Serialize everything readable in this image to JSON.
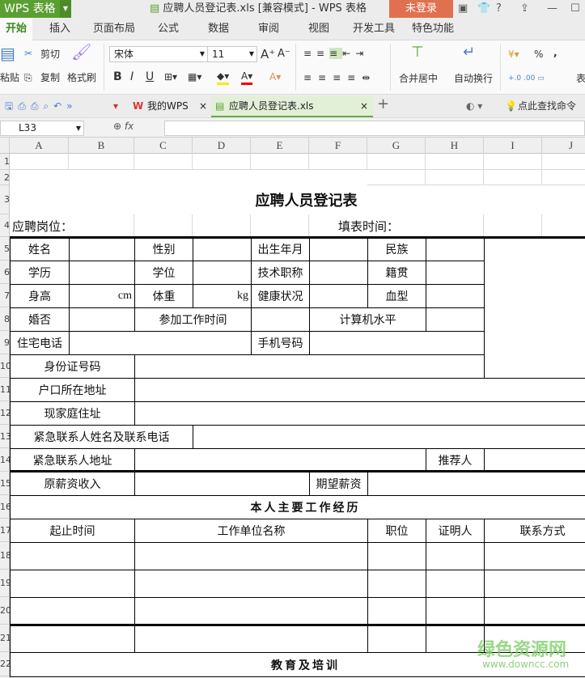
{
  "app": {
    "name": "WPS 表格",
    "title": "应聘人员登记表.xls [兼容模式] - WPS 表格",
    "login": "未登录",
    "help": "?"
  },
  "menu": [
    "开始",
    "插入",
    "页面布局",
    "公式",
    "数据",
    "审阅",
    "视图",
    "开发工具",
    "特色功能"
  ],
  "ribbon": {
    "paste": "粘贴",
    "cut": "剪切",
    "copy": "复制",
    "format_painter": "格式刷",
    "font": "宋体",
    "size": "11",
    "bold": "B",
    "italic": "I",
    "underline": "U",
    "merge": "合并居中",
    "wrap": "自动换行",
    "percent": "%",
    "comma": ",",
    "table_style": "表"
  },
  "tabs": {
    "mywps": "我的WPS",
    "doc": "应聘人员登记表.xls",
    "search": "点此查找命令"
  },
  "formula": {
    "cell": "L33",
    "fx": "fx",
    "value": ""
  },
  "columns": [
    "A",
    "B",
    "C",
    "D",
    "E",
    "F",
    "G",
    "H",
    "I",
    "J"
  ],
  "rows": [
    "1",
    "2",
    "3",
    "4",
    "5",
    "6",
    "7",
    "8",
    "9",
    "10",
    "11",
    "12",
    "13",
    "14",
    "15",
    "16",
    "17",
    "18",
    "19",
    "20",
    "21",
    "22"
  ],
  "sheet": {
    "title": "应聘人员登记表",
    "position": "应聘岗位：",
    "fill_date": "填表时间：",
    "name": "姓名",
    "gender": "性别",
    "birth": "出生年月",
    "ethnicity": "民族",
    "education": "学历",
    "degree": "学位",
    "tech_title": "技术职称",
    "native": "籍贯",
    "height": "身高",
    "cm": "cm",
    "weight": "体重",
    "kg": "kg",
    "health": "健康状况",
    "blood": "血型",
    "married": "婚否",
    "work_start": "参加工作时间",
    "computer": "计算机水平",
    "home_phone": "住宅电话",
    "mobile": "手机号码",
    "id_no": "身份证号码",
    "hukou": "户口所在地址",
    "address": "现家庭住址",
    "emergency": "紧急联系人姓名及联系电话",
    "emergency_addr": "紧急联系人地址",
    "referrer": "推荐人",
    "old_salary": "原薪资收入",
    "expected_salary": "期望薪资",
    "work_history": "本人主要工作经历",
    "period": "起止时间",
    "employer": "工作单位名称",
    "post": "职位",
    "witness": "证明人",
    "contact": "联系方式",
    "training": "教育及培训"
  },
  "watermark": {
    "cn": "绿色资源网",
    "url": "www.downcc.com"
  }
}
